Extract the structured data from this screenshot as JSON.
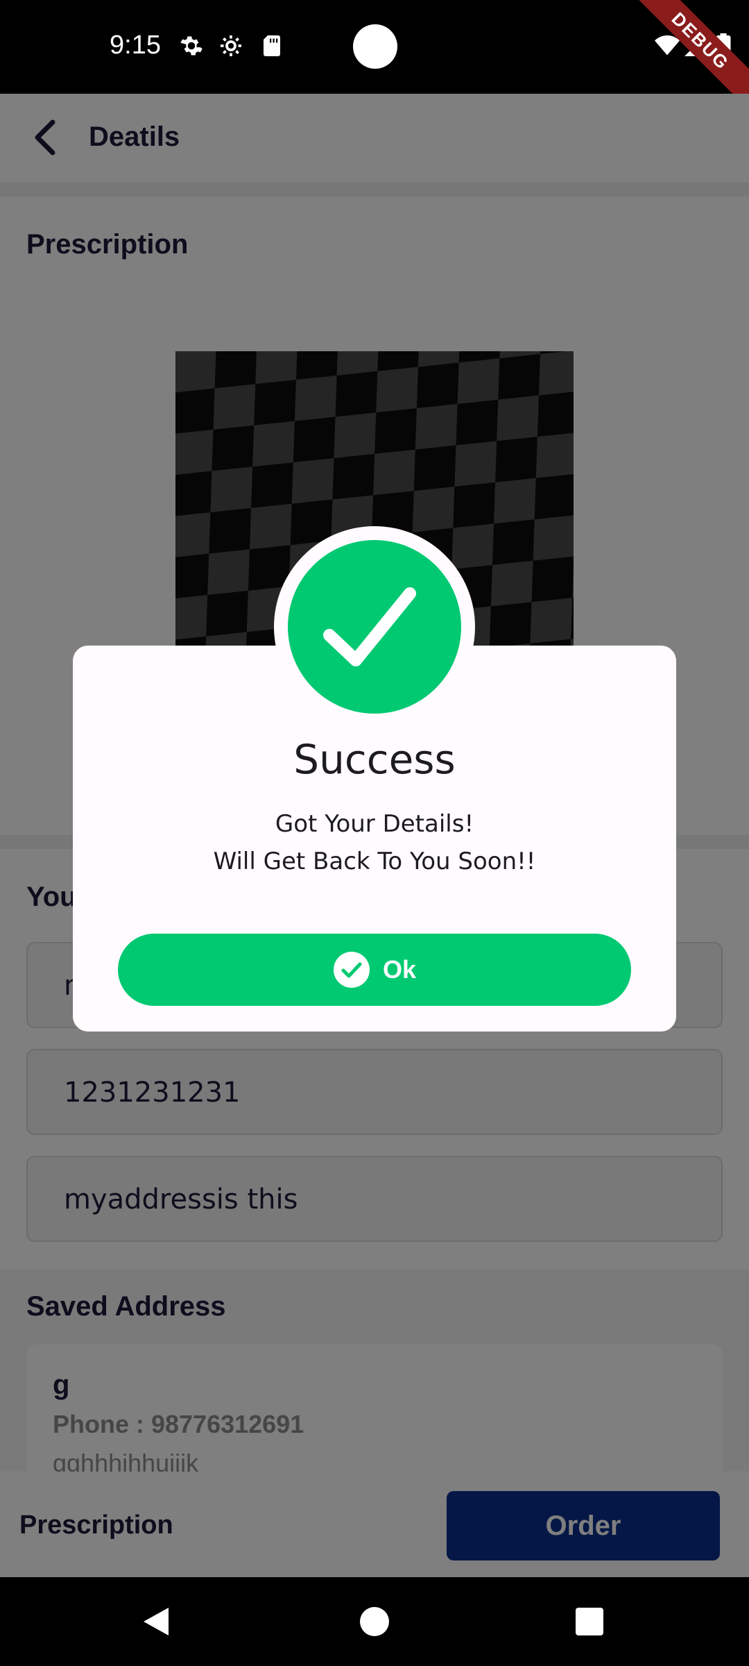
{
  "status_bar": {
    "time": "9:15",
    "icons": [
      "gear-icon",
      "settings-icon",
      "sd-card-icon",
      "wifi-icon",
      "signal-icon",
      "battery-icon"
    ],
    "debug_banner": "DEBUG"
  },
  "app_bar": {
    "back_icon": "chevron-left-icon",
    "title": "Deatils"
  },
  "prescription": {
    "title": "Prescription"
  },
  "form": {
    "title_visible": "You",
    "fields": [
      {
        "value": "m"
      },
      {
        "value": "1231231231"
      },
      {
        "value": "myaddressis this"
      }
    ]
  },
  "saved_address": {
    "title": "Saved Address",
    "card": {
      "name": "g",
      "phone": "Phone : 98776312691",
      "address": "gghhhjhhujiik"
    }
  },
  "bottom_bar": {
    "prescription_label": "Prescription",
    "order_label": "Order"
  },
  "dialog": {
    "icon": "check-icon",
    "title": "Success",
    "message_line1": "Got Your Details!",
    "message_line2": "Will Get Back To You Soon!!",
    "ok_label": "Ok"
  },
  "colors": {
    "success": "#00c972",
    "primary": "#0a2e8c",
    "text": "#1c1b3a"
  },
  "nav_bar": {
    "icons": [
      "nav-back-icon",
      "nav-home-icon",
      "nav-recents-icon"
    ]
  }
}
